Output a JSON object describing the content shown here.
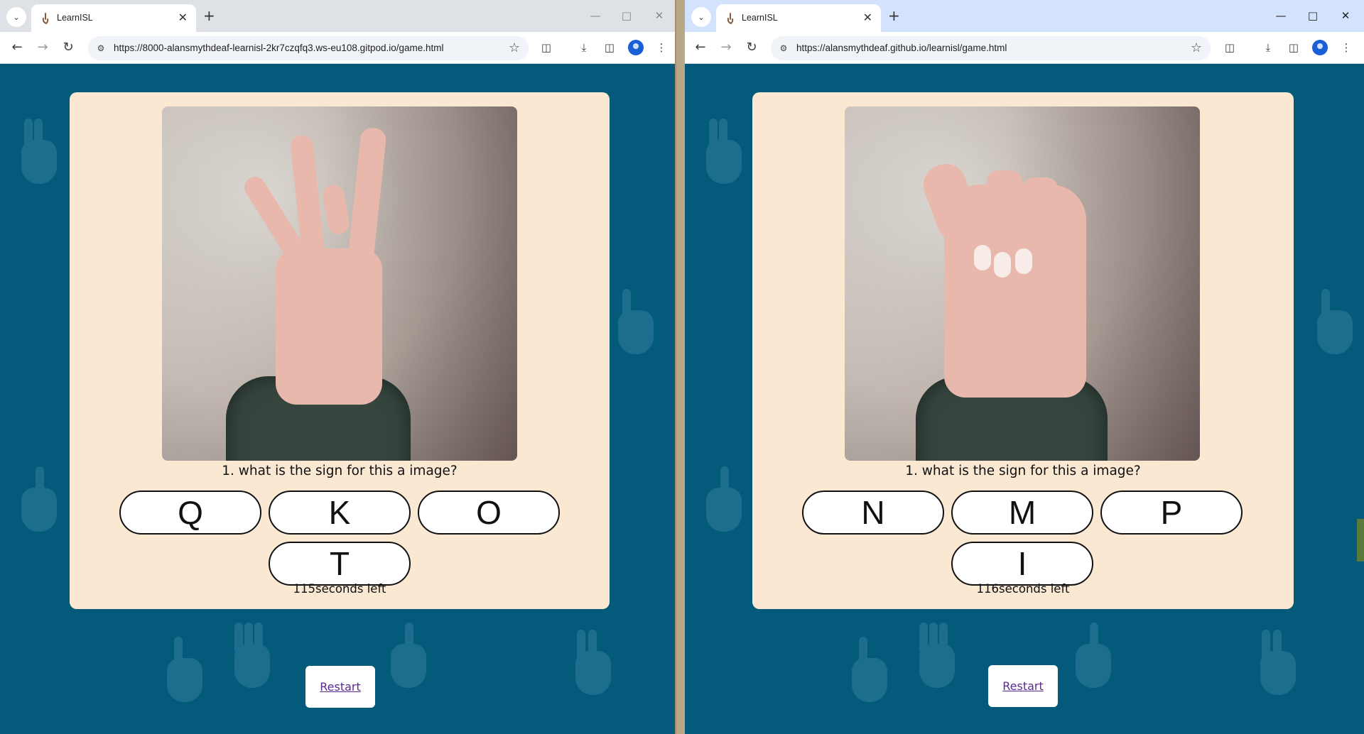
{
  "left": {
    "tab_title": "LearnISL",
    "url": "https://8000-alansmythdeaf-learnisl-2kr7czqfq3.ws-eu108.gitpod.io/game.html",
    "question": "1. what is the sign for this a image?",
    "answers": [
      "Q",
      "K",
      "O",
      "T"
    ],
    "timer": "115seconds left",
    "restart": "Restart"
  },
  "right": {
    "tab_title": "LearnISL",
    "url": "https://alansmythdeaf.github.io/learnisl/game.html",
    "question": "1. what is the sign for this a image?",
    "answers": [
      "N",
      "M",
      "P",
      "I"
    ],
    "timer": "116seconds left",
    "restart": "Restart"
  },
  "icons": {
    "tab_search": "chevron-down-icon",
    "favicon": "hand-favicon-icon",
    "close": "close-icon",
    "new_tab": "plus-icon",
    "minimize": "minimize-icon",
    "maximize": "maximize-icon",
    "window_close": "window-close-icon",
    "back": "back-arrow-icon",
    "forward": "forward-arrow-icon",
    "reload": "reload-icon",
    "site_info": "site-info-icon",
    "bookmark": "star-icon",
    "extensions": "puzzle-icon",
    "downloads": "download-icon",
    "side_panel": "side-panel-icon",
    "profile": "profile-icon",
    "menu": "kebab-menu-icon"
  },
  "colors": {
    "page_bg": "#035a7a",
    "card_bg": "#fae8d3",
    "link": "#5a2a8f"
  }
}
